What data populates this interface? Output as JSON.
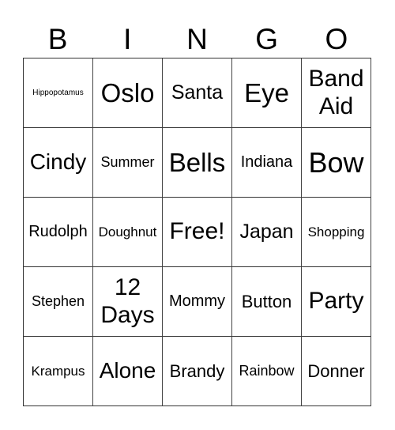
{
  "header": {
    "letters": [
      "B",
      "I",
      "N",
      "G",
      "O"
    ]
  },
  "grid": {
    "rows": [
      [
        "Hippopotamus",
        "Oslo",
        "Santa",
        "Eye",
        "Band Aid"
      ],
      [
        "Cindy",
        "Summer",
        "Bells",
        "Indiana",
        "Bow"
      ],
      [
        "Rudolph",
        "Doughnut",
        "Free!",
        "Japan",
        "Shopping"
      ],
      [
        "Stephen",
        "12 Days",
        "Mommy",
        "Button",
        "Party"
      ],
      [
        "Krampus",
        "Alone",
        "Brandy",
        "Rainbow",
        "Donner"
      ]
    ],
    "free_space": "Free!"
  },
  "colors": {
    "background": "#ffffff",
    "text": "#000000",
    "grid_line": "#333333"
  }
}
